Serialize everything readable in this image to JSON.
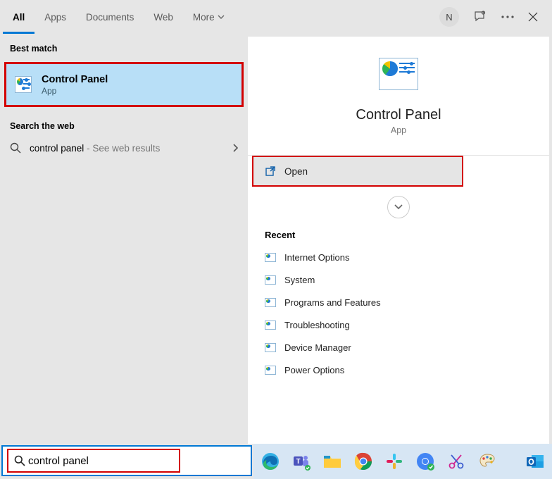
{
  "tabs": {
    "items": [
      "All",
      "Apps",
      "Documents",
      "Web",
      "More"
    ],
    "active_index": 0
  },
  "header_tools": {
    "avatar_initial": "N"
  },
  "left": {
    "best_match_label": "Best match",
    "best_match": {
      "title": "Control Panel",
      "subtitle": "App"
    },
    "search_web_label": "Search the web",
    "web_result": {
      "query": "control panel",
      "suffix": "See web results"
    }
  },
  "preview": {
    "title": "Control Panel",
    "subtitle": "App",
    "open_label": "Open"
  },
  "recent": {
    "title": "Recent",
    "items": [
      "Internet Options",
      "System",
      "Programs and Features",
      "Troubleshooting",
      "Device Manager",
      "Power Options"
    ]
  },
  "search": {
    "value": "control panel"
  },
  "taskbar_icons": [
    "edge",
    "teams",
    "file-explorer",
    "chrome",
    "slack",
    "chrome-alt",
    "snip",
    "paint",
    "outlook"
  ]
}
